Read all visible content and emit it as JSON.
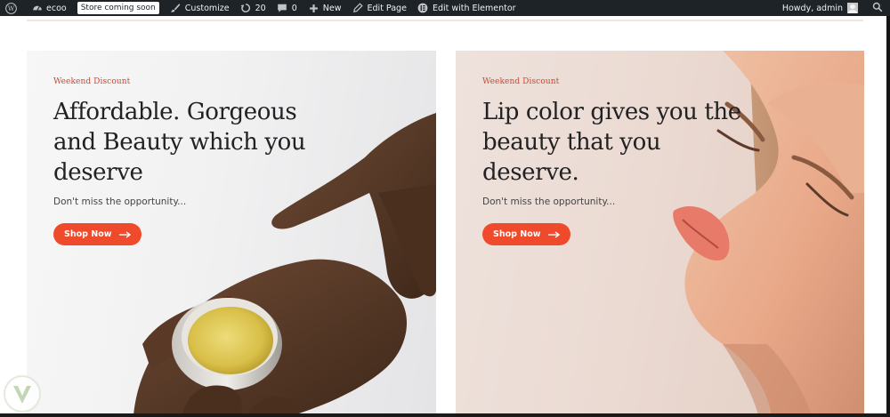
{
  "admin_bar": {
    "site_name": "ecoo",
    "store_badge": "Store coming soon",
    "customize": "Customize",
    "updates_count": "20",
    "comments_count": "0",
    "new": "New",
    "edit_page": "Edit Page",
    "edit_elementor": "Edit with Elementor",
    "howdy": "Howdy, admin"
  },
  "banners": [
    {
      "eyebrow": "Weekend Discount",
      "heading_lines": [
        "Affordable. Gorgeous",
        "and Beauty which you",
        "deserve"
      ],
      "subtitle": "Don't miss the opportunity...",
      "button": "Shop Now"
    },
    {
      "eyebrow": "Weekend Discount",
      "heading_lines": [
        "Lip color gives you the",
        "beauty that you",
        "deserve."
      ],
      "subtitle": "Don't miss the opportunity...",
      "button": "Shop Now"
    }
  ],
  "colors": {
    "accent": "#ee4a2b",
    "eyebrow": "#d1442c",
    "admin_bar": "#1d2327"
  }
}
